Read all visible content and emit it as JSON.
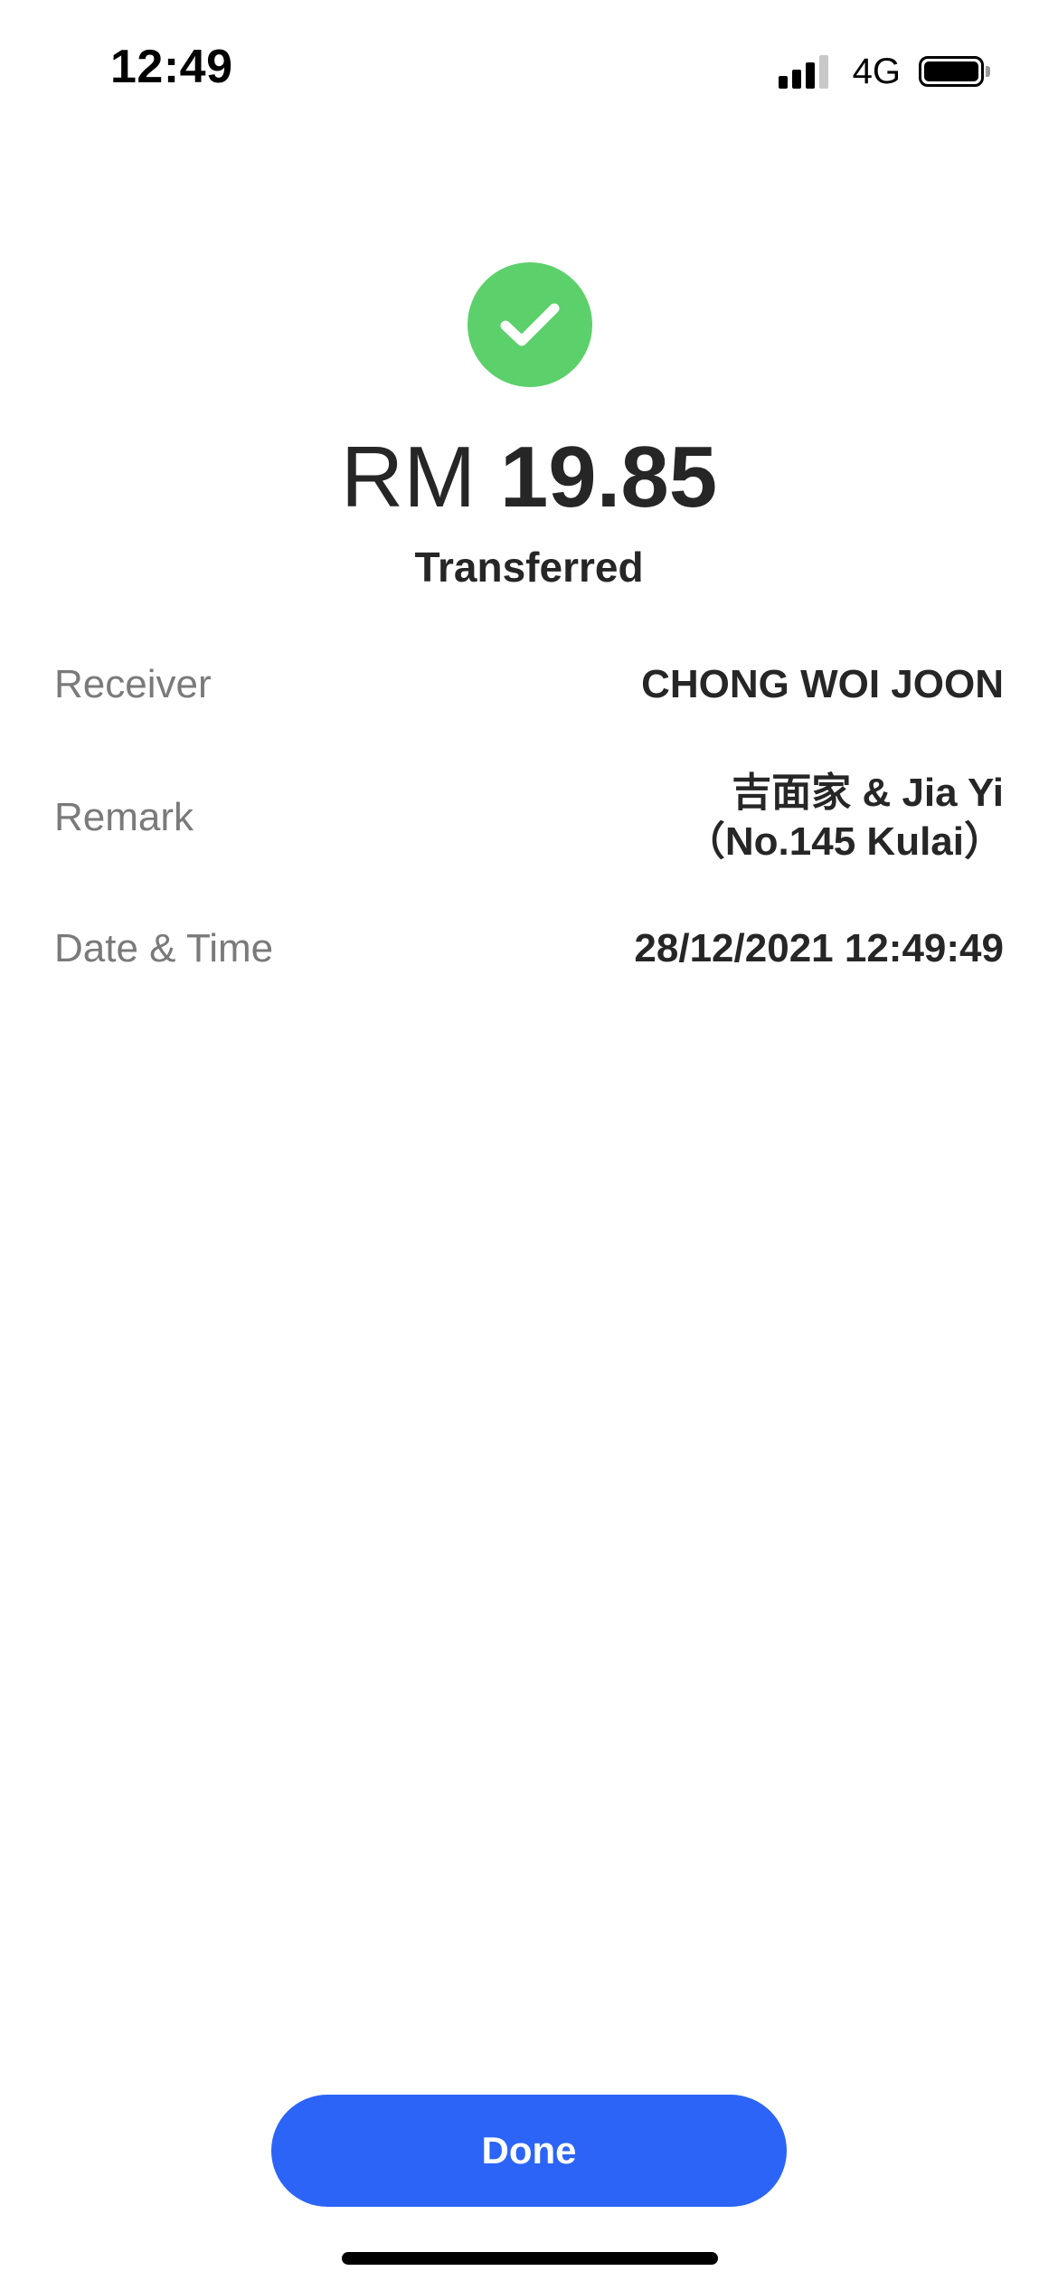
{
  "status_bar": {
    "time": "12:49",
    "network": "4G",
    "signal_bars_active": 3,
    "signal_bars_total": 4,
    "battery_level": 1.0
  },
  "receipt": {
    "icon": "check-circle-icon",
    "currency": "RM",
    "amount": "19.85",
    "status": "Transferred",
    "details": {
      "receiver_label": "Receiver",
      "receiver_value": "CHONG WOI JOON",
      "remark_label": "Remark",
      "remark_line1": "吉面家 & Jia Yi",
      "remark_line2": "（No.145 Kulai）",
      "datetime_label": "Date & Time",
      "datetime_value": "28/12/2021 12:49:49"
    }
  },
  "actions": {
    "done_label": "Done"
  },
  "colors": {
    "success": "#5bd06b",
    "primary": "#2b64f6"
  }
}
